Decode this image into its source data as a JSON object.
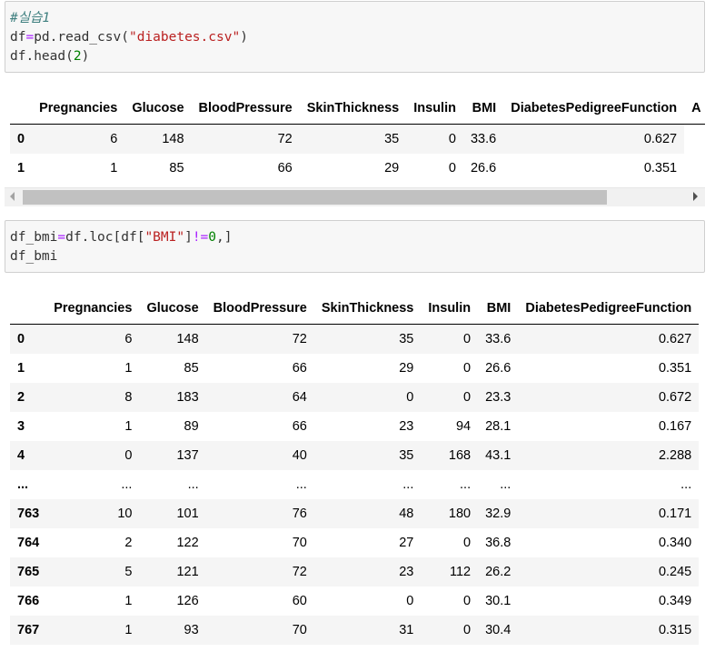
{
  "cell1": {
    "comment": "#실습1",
    "line2": {
      "var": "df",
      "op": "=",
      "pre": "pd.read_csv(",
      "str": "\"diabetes.csv\"",
      "post": ")"
    },
    "line3": {
      "pre": "df.head(",
      "num": "2",
      "post": ")"
    }
  },
  "output1": {
    "columns": [
      "",
      "Pregnancies",
      "Glucose",
      "BloodPressure",
      "SkinThickness",
      "Insulin",
      "BMI",
      "DiabetesPedigreeFunction",
      "A"
    ],
    "rows": [
      [
        "0",
        "6",
        "148",
        "72",
        "35",
        "0",
        "33.6",
        "0.627"
      ],
      [
        "1",
        "1",
        "85",
        "66",
        "29",
        "0",
        "26.6",
        "0.351"
      ]
    ]
  },
  "cell2": {
    "line1": {
      "pre": "df_bmi",
      "op1": "=",
      "mid": "df.loc[df[",
      "str": "\"BMI\"",
      "close": "]",
      "op2": "!=",
      "num": "0",
      "post": ",]"
    },
    "line2": "df_bmi"
  },
  "output2": {
    "columns": [
      "",
      "Pregnancies",
      "Glucose",
      "BloodPressure",
      "SkinThickness",
      "Insulin",
      "BMI",
      "DiabetesPedigreeFunction"
    ],
    "rows": [
      [
        "0",
        "6",
        "148",
        "72",
        "35",
        "0",
        "33.6",
        "0.627"
      ],
      [
        "1",
        "1",
        "85",
        "66",
        "29",
        "0",
        "26.6",
        "0.351"
      ],
      [
        "2",
        "8",
        "183",
        "64",
        "0",
        "0",
        "23.3",
        "0.672"
      ],
      [
        "3",
        "1",
        "89",
        "66",
        "23",
        "94",
        "28.1",
        "0.167"
      ],
      [
        "4",
        "0",
        "137",
        "40",
        "35",
        "168",
        "43.1",
        "2.288"
      ],
      [
        "...",
        "...",
        "...",
        "...",
        "...",
        "...",
        "...",
        "..."
      ],
      [
        "763",
        "10",
        "101",
        "76",
        "48",
        "180",
        "32.9",
        "0.171"
      ],
      [
        "764",
        "2",
        "122",
        "70",
        "27",
        "0",
        "36.8",
        "0.340"
      ],
      [
        "765",
        "5",
        "121",
        "72",
        "23",
        "112",
        "26.2",
        "0.245"
      ],
      [
        "766",
        "1",
        "126",
        "60",
        "0",
        "0",
        "30.1",
        "0.349"
      ],
      [
        "767",
        "1",
        "93",
        "70",
        "31",
        "0",
        "30.4",
        "0.315"
      ]
    ]
  }
}
